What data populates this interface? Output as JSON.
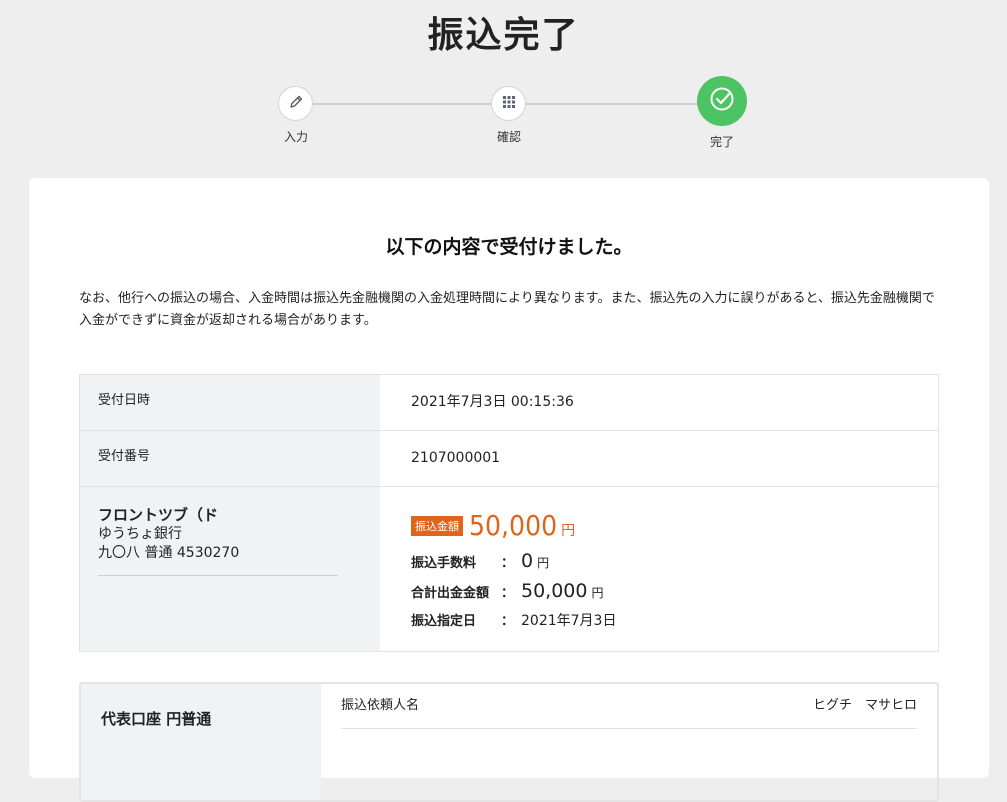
{
  "page": {
    "title": "振込完了"
  },
  "stepper": {
    "steps": [
      {
        "label": "入力",
        "icon": "pencil-icon",
        "state": "done"
      },
      {
        "label": "確認",
        "icon": "grid-icon",
        "state": "done"
      },
      {
        "label": "完了",
        "icon": "check-circle-icon",
        "state": "active"
      }
    ],
    "active_color": "#4cc464"
  },
  "result": {
    "heading": "以下の内容で受付けました。",
    "notice": "なお、他行への振込の場合、入金時間は振込先金融機関の入金処理時間により異なります。また、振込先の入力に誤りがあると、振込先金融機関で入金ができずに資金が返却される場合があります。"
  },
  "details": {
    "receipt_datetime_label": "受付日時",
    "receipt_datetime_value": "2021年7月3日 00:15:36",
    "receipt_number_label": "受付番号",
    "receipt_number_value": "2107000001",
    "payee": {
      "name": "フロントツブ（ド",
      "bank": "ゆうちょ銀行",
      "account": "九〇八 普通 4530270"
    },
    "amount_badge": "振込金額",
    "amount": "50,000",
    "amount_unit": "円",
    "fee_label": "振込手数料",
    "fee_value": "0",
    "fee_unit": "円",
    "total_label": "合計出金金額",
    "total_value": "50,000",
    "total_unit": "円",
    "date_label": "振込指定日",
    "date_value": "2021年7月3日",
    "colon": "："
  },
  "account": {
    "name": "代表口座 円普通",
    "requester_label": "振込依頼人名",
    "requester_value": "ヒグチ　マサヒロ"
  },
  "colors": {
    "accent_orange": "#e0641c",
    "success_green": "#4cc464"
  }
}
